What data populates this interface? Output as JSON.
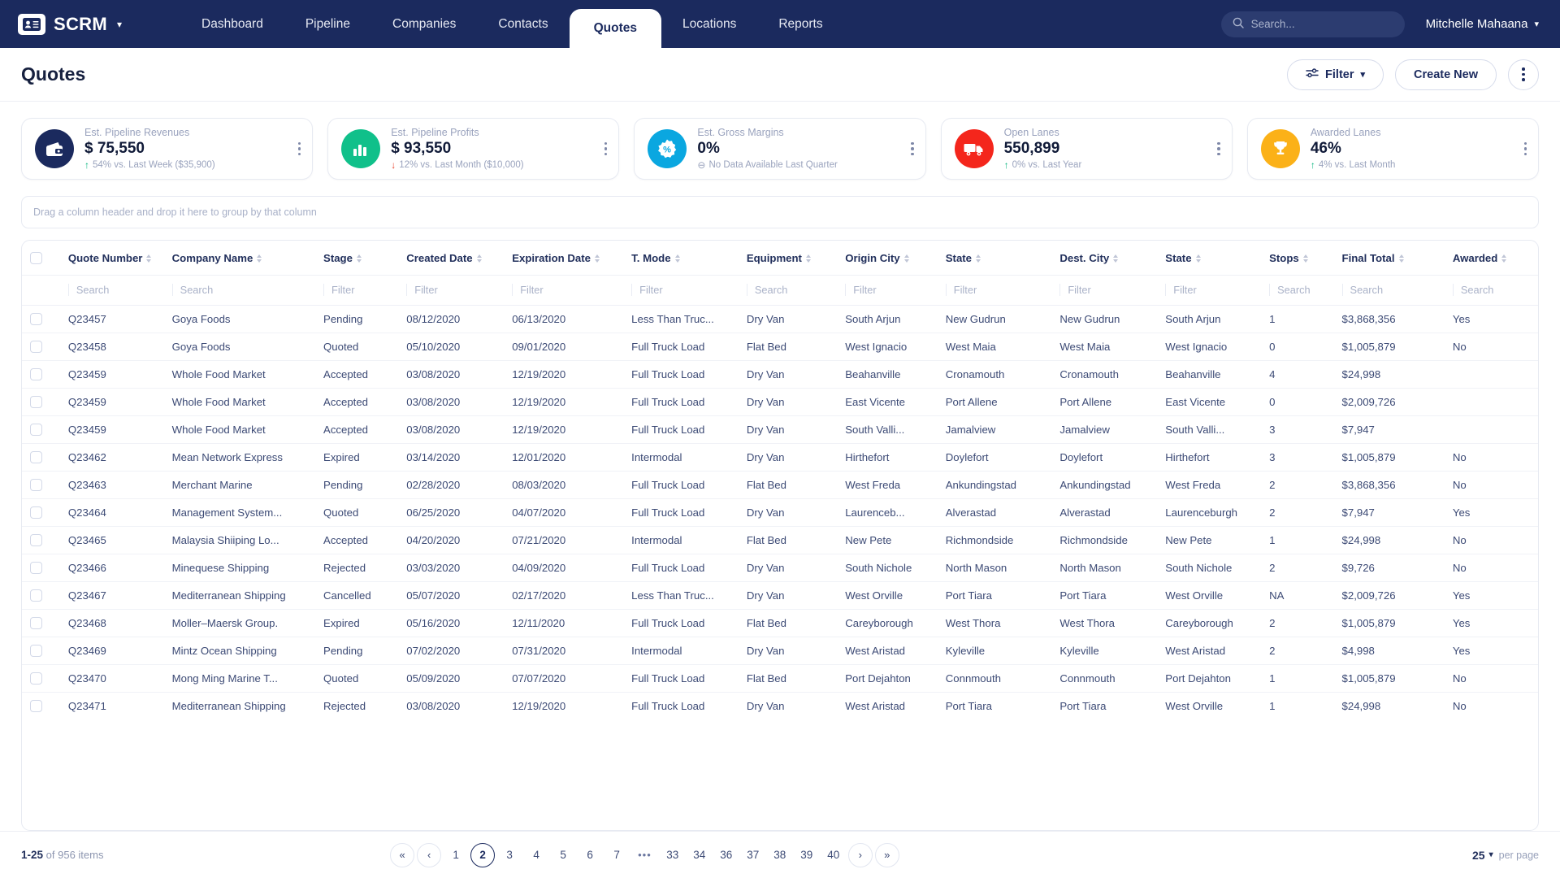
{
  "nav": {
    "brand": "SCRM",
    "brand_icon": "contact-card-icon",
    "items": [
      {
        "label": "Dashboard",
        "active": false
      },
      {
        "label": "Pipeline",
        "active": false
      },
      {
        "label": "Companies",
        "active": false
      },
      {
        "label": "Contacts",
        "active": false
      },
      {
        "label": "Quotes",
        "active": true
      },
      {
        "label": "Locations",
        "active": false
      },
      {
        "label": "Reports",
        "active": false
      }
    ],
    "search_placeholder": "Search...",
    "user": "Mitchelle Mahaana"
  },
  "titlebar": {
    "title": "Quotes",
    "filter_label": "Filter",
    "create_label": "Create New"
  },
  "kpis": [
    {
      "label": "Est. Pipeline Revenues",
      "value": "$ 75,550",
      "trend_dir": "up",
      "trend_arrow": "↑",
      "trend_text": "54% vs. Last Week ($35,900)",
      "icon": "wallet-icon",
      "color": "#1b2a5e"
    },
    {
      "label": "Est. Pipeline Profits",
      "value": "$ 93,550",
      "trend_dir": "down",
      "trend_arrow": "↓",
      "trend_text": "12% vs. Last Month ($10,000)",
      "icon": "bar-chart-icon",
      "color": "#10c08a"
    },
    {
      "label": "Est. Gross Margins",
      "value": "0%",
      "trend_dir": "neutral",
      "trend_arrow": "⊖",
      "trend_text": "No Data Available Last Quarter",
      "icon": "percent-badge-icon",
      "color": "#0aa7e0"
    },
    {
      "label": "Open Lanes",
      "value": "550,899",
      "trend_dir": "up",
      "trend_arrow": "↑",
      "trend_text": "0% vs. Last Year",
      "icon": "truck-icon",
      "color": "#f4261c"
    },
    {
      "label": "Awarded Lanes",
      "value": "46%",
      "trend_dir": "up",
      "trend_arrow": "↑",
      "trend_text": "4% vs. Last Month",
      "icon": "trophy-icon",
      "color": "#fbb118"
    }
  ],
  "groupbar": {
    "hint": "Drag a column header and drop it here to group by that column"
  },
  "table": {
    "columns": [
      {
        "label": "Quote Number",
        "filter": "Search"
      },
      {
        "label": "Company Name",
        "filter": "Search"
      },
      {
        "label": "Stage",
        "filter": "Filter"
      },
      {
        "label": "Created Date",
        "filter": "Filter"
      },
      {
        "label": "Expiration Date",
        "filter": "Filter"
      },
      {
        "label": "T. Mode",
        "filter": "Filter"
      },
      {
        "label": "Equipment",
        "filter": "Search"
      },
      {
        "label": "Origin City",
        "filter": "Filter"
      },
      {
        "label": "State",
        "filter": "Filter"
      },
      {
        "label": "Dest. City",
        "filter": "Filter"
      },
      {
        "label": "State",
        "filter": "Filter"
      },
      {
        "label": "Stops",
        "filter": "Search"
      },
      {
        "label": "Final Total",
        "filter": "Search"
      },
      {
        "label": "Awarded",
        "filter": "Search"
      }
    ],
    "rows": [
      [
        "Q23457",
        "Goya Foods",
        "Pending",
        "08/12/2020",
        "06/13/2020",
        "Less Than Truc...",
        "Dry Van",
        "South Arjun",
        "New Gudrun",
        "New Gudrun",
        "South Arjun",
        "1",
        "$3,868,356",
        "Yes"
      ],
      [
        "Q23458",
        "Goya Foods",
        "Quoted",
        "05/10/2020",
        "09/01/2020",
        "Full Truck Load",
        "Flat Bed",
        "West Ignacio",
        "West Maia",
        "West Maia",
        "West Ignacio",
        "0",
        "$1,005,879",
        "No"
      ],
      [
        "Q23459",
        "Whole Food Market",
        "Accepted",
        "03/08/2020",
        "12/19/2020",
        "Full Truck Load",
        "Dry Van",
        "Beahanville",
        "Cronamouth",
        "Cronamouth",
        "Beahanville",
        "4",
        "$24,998",
        ""
      ],
      [
        "Q23459",
        "Whole Food Market",
        "Accepted",
        "03/08/2020",
        "12/19/2020",
        "Full Truck Load",
        "Dry Van",
        "East Vicente",
        "Port Allene",
        "Port Allene",
        "East Vicente",
        "0",
        "$2,009,726",
        ""
      ],
      [
        "Q23459",
        "Whole Food Market",
        "Accepted",
        "03/08/2020",
        "12/19/2020",
        "Full Truck Load",
        "Dry Van",
        "South Valli...",
        "Jamalview",
        "Jamalview",
        "South Valli...",
        "3",
        "$7,947",
        ""
      ],
      [
        "Q23462",
        "Mean Network Express",
        "Expired",
        "03/14/2020",
        "12/01/2020",
        "Intermodal",
        "Dry Van",
        "Hirthefort",
        "Doylefort",
        "Doylefort",
        "Hirthefort",
        "3",
        "$1,005,879",
        "No"
      ],
      [
        "Q23463",
        "Merchant Marine",
        "Pending",
        "02/28/2020",
        "08/03/2020",
        "Full Truck Load",
        "Flat Bed",
        "West Freda",
        "Ankundingstad",
        "Ankundingstad",
        "West Freda",
        "2",
        "$3,868,356",
        "No"
      ],
      [
        "Q23464",
        "Management System...",
        "Quoted",
        "06/25/2020",
        "04/07/2020",
        "Full Truck Load",
        "Dry Van",
        "Laurenceb...",
        "Alverastad",
        "Alverastad",
        "Laurenceburgh",
        "2",
        "$7,947",
        "Yes"
      ],
      [
        "Q23465",
        "Malaysia Shiiping Lo...",
        "Accepted",
        "04/20/2020",
        "07/21/2020",
        "Intermodal",
        "Flat Bed",
        "New Pete",
        "Richmondside",
        "Richmondside",
        "New Pete",
        "1",
        "$24,998",
        "No"
      ],
      [
        "Q23466",
        "Minequese Shipping",
        "Rejected",
        "03/03/2020",
        "04/09/2020",
        "Full Truck Load",
        "Dry Van",
        "South Nichole",
        "North Mason",
        "North Mason",
        "South Nichole",
        "2",
        "$9,726",
        "No"
      ],
      [
        "Q23467",
        "Mediterranean Shipping",
        "Cancelled",
        "05/07/2020",
        "02/17/2020",
        "Less Than Truc...",
        "Dry Van",
        "West Orville",
        "Port Tiara",
        "Port Tiara",
        "West Orville",
        "NA",
        "$2,009,726",
        "Yes"
      ],
      [
        "Q23468",
        "Moller–Maersk Group.",
        "Expired",
        "05/16/2020",
        "12/11/2020",
        "Full Truck Load",
        "Flat Bed",
        "Careyborough",
        "West Thora",
        "West Thora",
        "Careyborough",
        "2",
        "$1,005,879",
        "Yes"
      ],
      [
        "Q23469",
        "Mintz Ocean Shipping",
        "Pending",
        "07/02/2020",
        "07/31/2020",
        "Intermodal",
        "Dry Van",
        "West Aristad",
        "Kyleville",
        "Kyleville",
        "West Aristad",
        "2",
        "$4,998",
        "Yes"
      ],
      [
        "Q23470",
        "Mong Ming Marine T...",
        "Quoted",
        "05/09/2020",
        "07/07/2020",
        "Full Truck Load",
        "Flat Bed",
        "Port Dejahton",
        "Connmouth",
        "Connmouth",
        "Port Dejahton",
        "1",
        "$1,005,879",
        "No"
      ],
      [
        "Q23471",
        "Mediterranean Shipping",
        "Rejected",
        "03/08/2020",
        "12/19/2020",
        "Full Truck Load",
        "Dry Van",
        "West Aristad",
        "Port Tiara",
        "Port Tiara",
        "West Orville",
        "1",
        "$24,998",
        "No"
      ]
    ]
  },
  "footer": {
    "range": "1-25",
    "count_text": "of 956 items",
    "pages": [
      "1",
      "2",
      "3",
      "4",
      "5",
      "6",
      "7",
      "...",
      "33",
      "34",
      "36",
      "37",
      "38",
      "39",
      "40"
    ],
    "current_page": "2",
    "first_label": "«",
    "prev_label": "‹",
    "next_label": "›",
    "last_label": "»",
    "per_page_value": "25",
    "per_page_label": "per page"
  }
}
